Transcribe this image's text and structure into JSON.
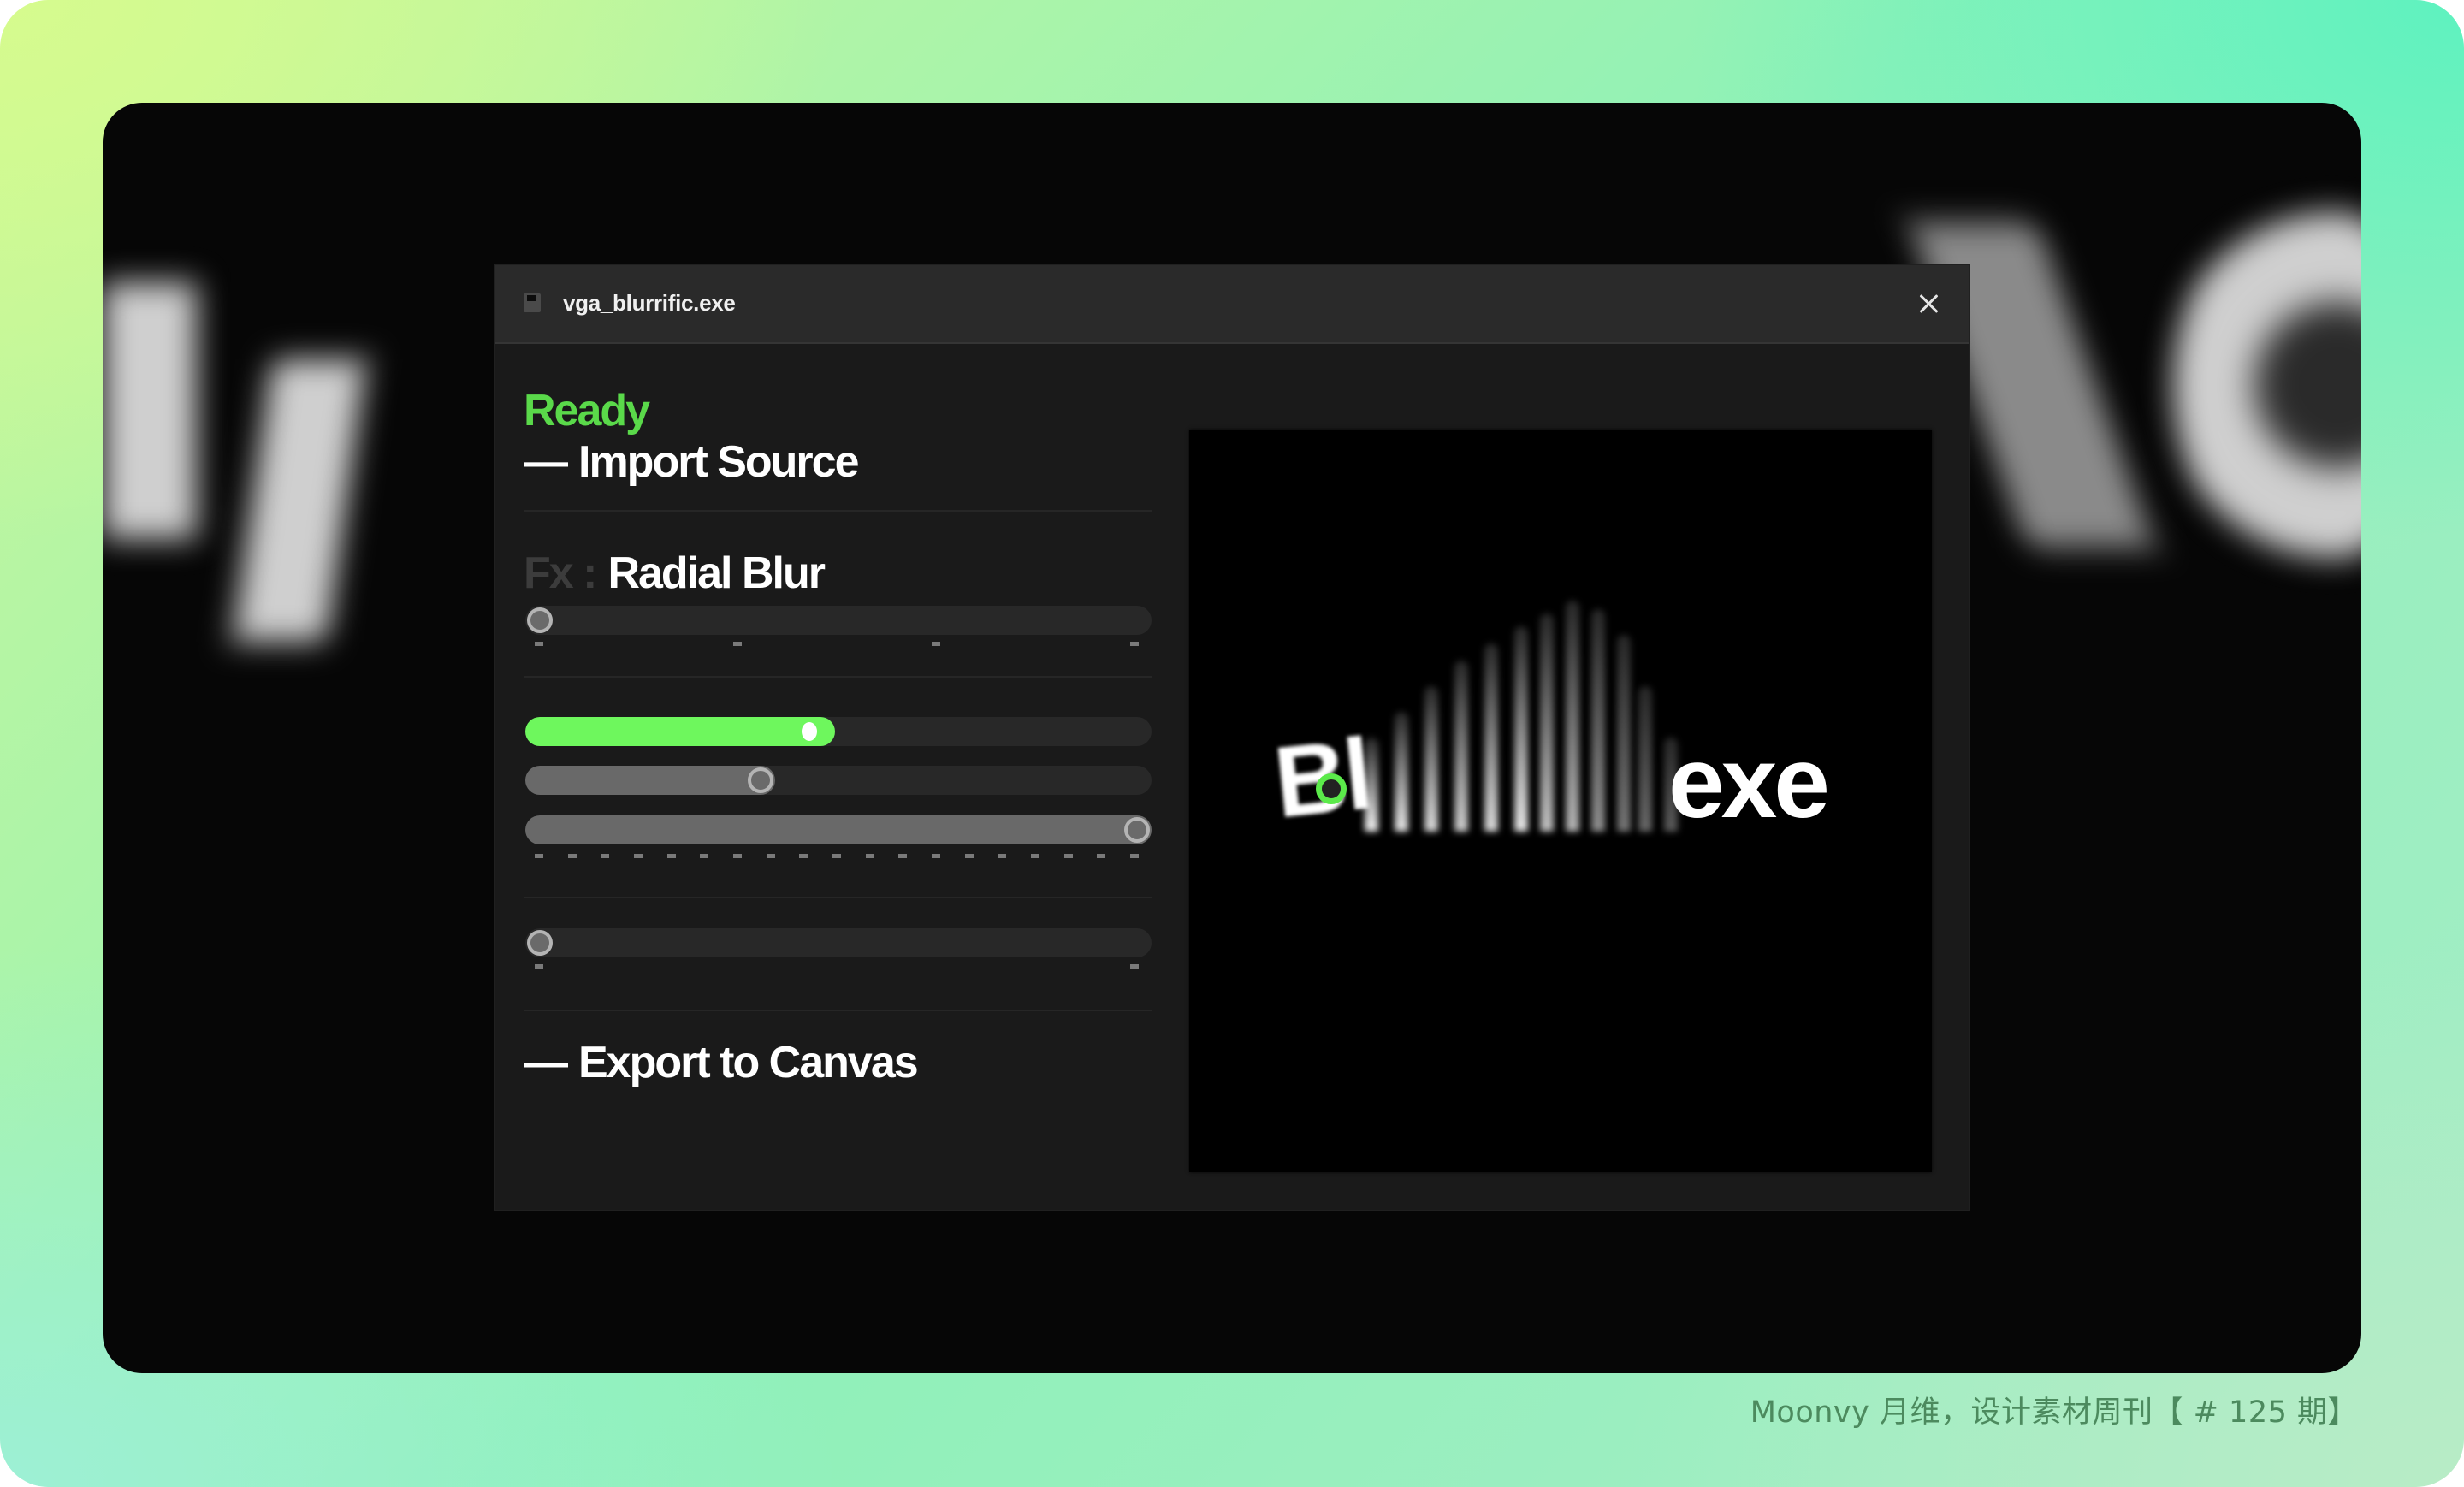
{
  "window": {
    "title": "vga_blurrific.exe",
    "file_icon": "floppy-disk-icon",
    "close_icon": "close-icon"
  },
  "panel": {
    "status": "Ready",
    "import_heading": {
      "dash": "—",
      "label": "Import Source"
    },
    "effect": {
      "prefix": "Fx :",
      "name": "Radial Blur"
    },
    "export_heading": {
      "dash": "—",
      "label": "Export to Canvas"
    },
    "sliders": [
      {
        "name": "effect-selector-slider",
        "value": 0,
        "style": "plain",
        "ticks": 4
      },
      {
        "name": "blur-strength-slider",
        "value": 0.47,
        "style": "green",
        "ticks": 0
      },
      {
        "name": "blur-slider-2",
        "value": 0.37,
        "style": "grey",
        "ticks": 0
      },
      {
        "name": "blur-slider-3",
        "value": 1.0,
        "style": "grey",
        "ticks": 19
      },
      {
        "name": "output-slider",
        "value": 0,
        "style": "plain",
        "ticks": 2
      }
    ]
  },
  "preview": {
    "text_start": "Bl",
    "text_end": "exe",
    "source_text": "Blurrific.exe",
    "center_handle_color": "#5bea4a"
  },
  "colors": {
    "accent_green": "#6ef75d",
    "status_green": "#5ad94a"
  },
  "watermark": "Moonvy 月维，设计素材周刊【 # 125 期】"
}
